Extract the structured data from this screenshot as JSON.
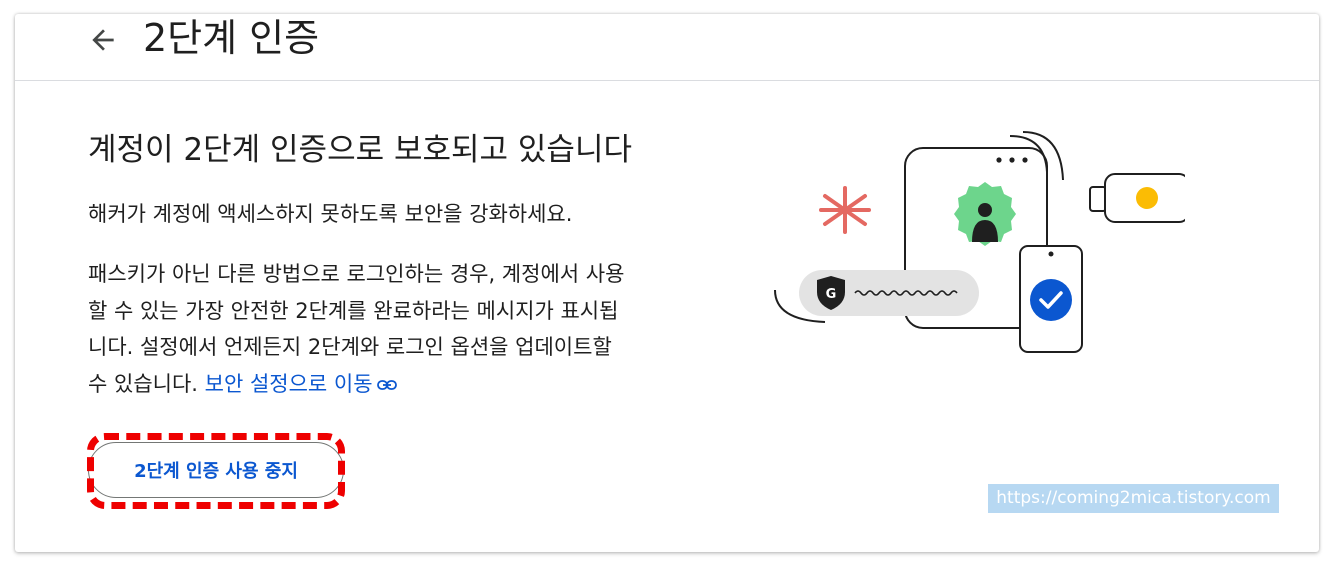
{
  "header": {
    "title": "2단계 인증",
    "back_icon": "arrow-back-icon"
  },
  "main": {
    "headline": "계정이 2단계 인증으로 보호되고 있습니다",
    "paragraph1": "해커가 계정에 액세스하지 못하도록 보안을 강화하세요.",
    "paragraph2_lines": [
      "패스키가 아닌 다른 방법으로 로그인하는 경우, 계정에서 사용",
      "할 수 있는 가장 안전한 2단계를 완료하라는 메시지가 표시됩",
      "니다. 설정에서 언제든지 2단계와 로그인 옵션을 업데이트할",
      "수 있습니다."
    ],
    "link_label": "보안 설정으로 이동",
    "link_icon": "link-icon",
    "disable_button_label": "2단계 인증 사용 중지"
  },
  "illustration": {
    "icons": [
      "asterisk-icon",
      "phone-icon",
      "avatar-badge-icon",
      "shield-g-icon",
      "check-icon",
      "security-key-icon"
    ],
    "colors": {
      "accent_blue": "#0b57d0",
      "badge_green": "#6dd58c",
      "asterisk_red": "#e46962",
      "key_dot_yellow": "#fbbc04",
      "pill_gray": "#e3e3e3"
    }
  },
  "watermark": "https://coming2mica.tistory.com",
  "colors": {
    "link": "#0b57d0",
    "highlight": "#ee0000",
    "text": "#1f1f1f"
  }
}
